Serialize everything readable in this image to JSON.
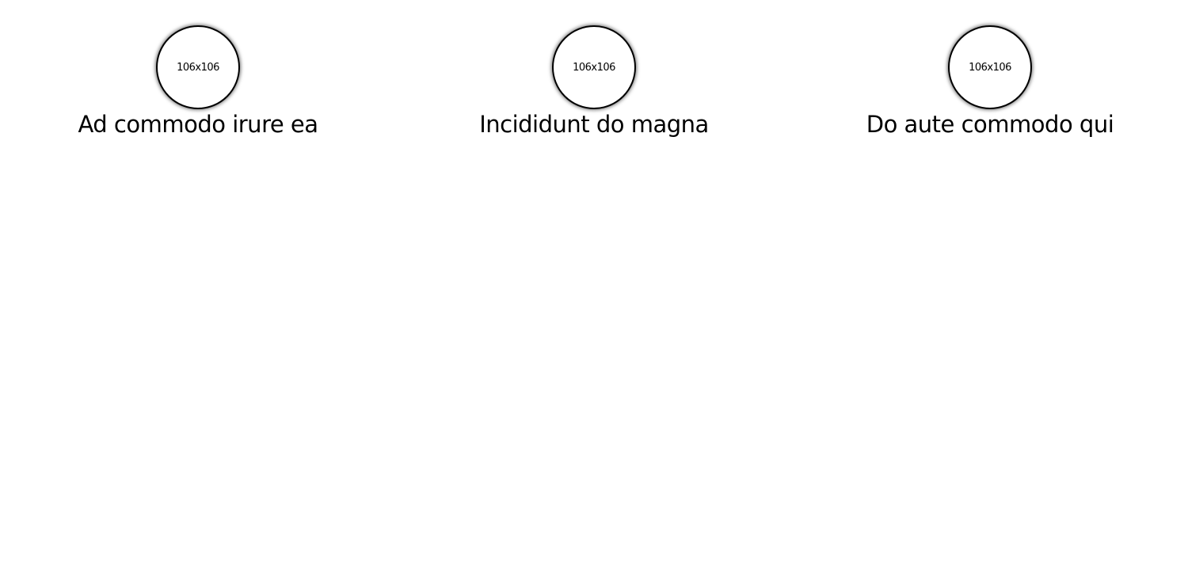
{
  "features": [
    {
      "image_label": "106x106",
      "caption": "Ad commodo irure ea"
    },
    {
      "image_label": "106x106",
      "caption": "Incididunt do magna"
    },
    {
      "image_label": "106x106",
      "caption": "Do aute commodo qui"
    }
  ]
}
